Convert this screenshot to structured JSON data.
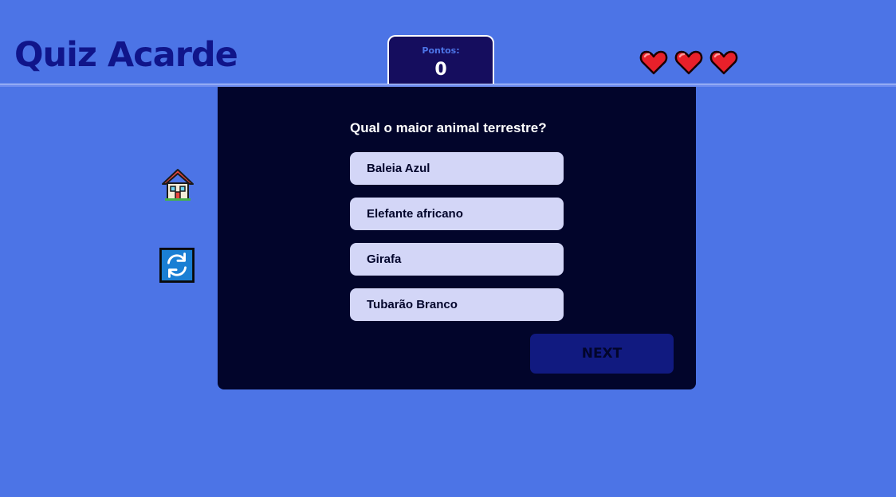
{
  "header": {
    "logo": "Quiz Acarde",
    "score": {
      "label": "Pontos:",
      "value": "0"
    },
    "lives": {
      "count": 3,
      "icon": "heart-icon",
      "color": "#e8202a"
    }
  },
  "sidebar": {
    "home_icon": "house-icon",
    "restart_icon": "refresh-icon"
  },
  "quiz": {
    "question": "Qual o maior animal terrestre?",
    "answers": [
      "Baleia Azul",
      "Elefante africano",
      "Girafa",
      "Tubarão Branco"
    ],
    "next_label": "NEXT"
  },
  "colors": {
    "background": "#4c74e6",
    "card": "#02052b",
    "answer": "#d3d6f7",
    "next_button": "#111a80",
    "logo": "#10158a"
  }
}
